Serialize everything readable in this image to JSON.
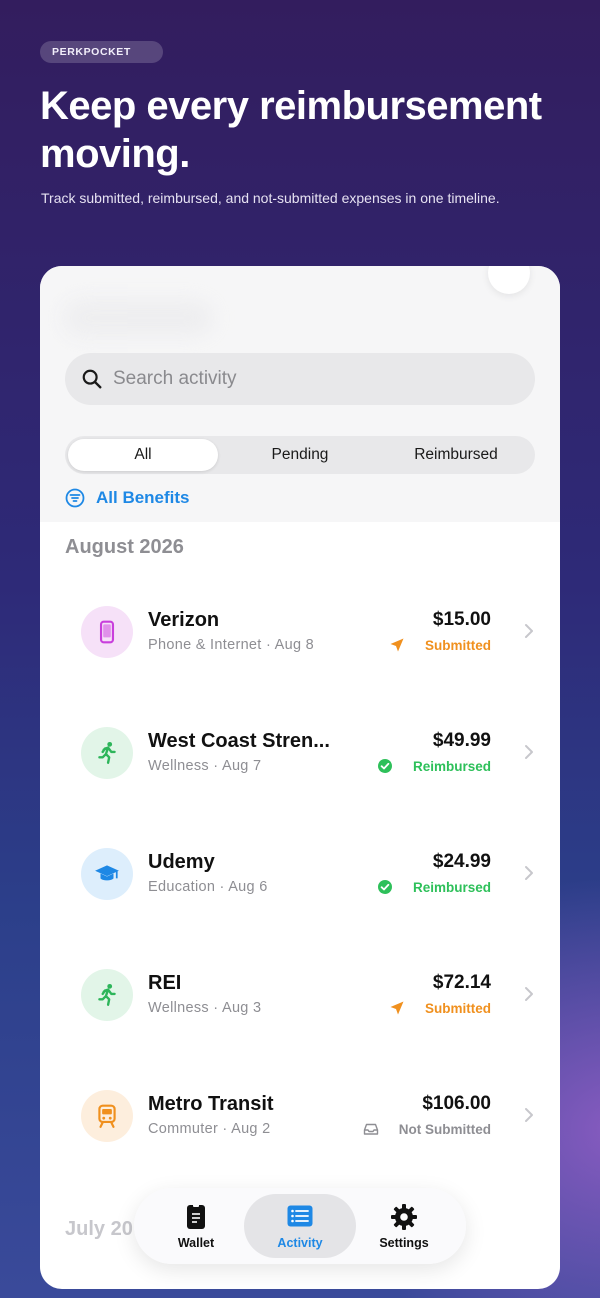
{
  "promo": {
    "badge": "PERKPOCKET",
    "headline": "Keep every reimbursement moving.",
    "subline": "Track submitted, reimbursed, and not-submitted expenses in one timeline."
  },
  "search": {
    "placeholder": "Search activity"
  },
  "segments": [
    {
      "label": "All",
      "active": true
    },
    {
      "label": "Pending",
      "active": false
    },
    {
      "label": "Reimbursed",
      "active": false
    }
  ],
  "filter": {
    "label": "All Benefits",
    "icon": "filter-icon"
  },
  "sections": [
    {
      "month": "August 2026",
      "items": [
        {
          "merchant": "Verizon",
          "category": "Phone & Internet",
          "date": "Aug 8",
          "amount": "$15.00",
          "status": "Submitted",
          "status_color": "#f0901e",
          "icon": "phone-icon",
          "icon_color": "#c93fdc",
          "icon_bg": "#f6e1f8"
        },
        {
          "merchant": "West Coast Stren...",
          "category": "Wellness",
          "date": "Aug 7",
          "amount": "$49.99",
          "status": "Reimbursed",
          "status_color": "#2ec05a",
          "icon": "runner-icon",
          "icon_color": "#2db55a",
          "icon_bg": "#e2f5e8"
        },
        {
          "merchant": "Udemy",
          "category": "Education",
          "date": "Aug 6",
          "amount": "$24.99",
          "status": "Reimbursed",
          "status_color": "#2ec05a",
          "icon": "graduation-cap-icon",
          "icon_color": "#1e88e5",
          "icon_bg": "#ddeefc"
        },
        {
          "merchant": "REI",
          "category": "Wellness",
          "date": "Aug 3",
          "amount": "$72.14",
          "status": "Submitted",
          "status_color": "#f0901e",
          "icon": "runner-icon",
          "icon_color": "#2db55a",
          "icon_bg": "#e2f5e8"
        },
        {
          "merchant": "Metro Transit",
          "category": "Commuter",
          "date": "Aug 2",
          "amount": "$106.00",
          "status": "Not Submitted",
          "status_color": "#8e8e93",
          "icon": "train-icon",
          "icon_color": "#f0901e",
          "icon_bg": "#fdeedd"
        }
      ]
    },
    {
      "month": "July 20"
    }
  ],
  "tabbar": [
    {
      "label": "Wallet",
      "icon": "wallet-icon",
      "active": false
    },
    {
      "label": "Activity",
      "icon": "activity-list-icon",
      "active": true
    },
    {
      "label": "Settings",
      "icon": "gear-icon",
      "active": false
    }
  ],
  "colors": {
    "accent": "#1e88e5",
    "submitted": "#f0901e",
    "reimbursed": "#2ec05a",
    "muted": "#8e8e93"
  }
}
